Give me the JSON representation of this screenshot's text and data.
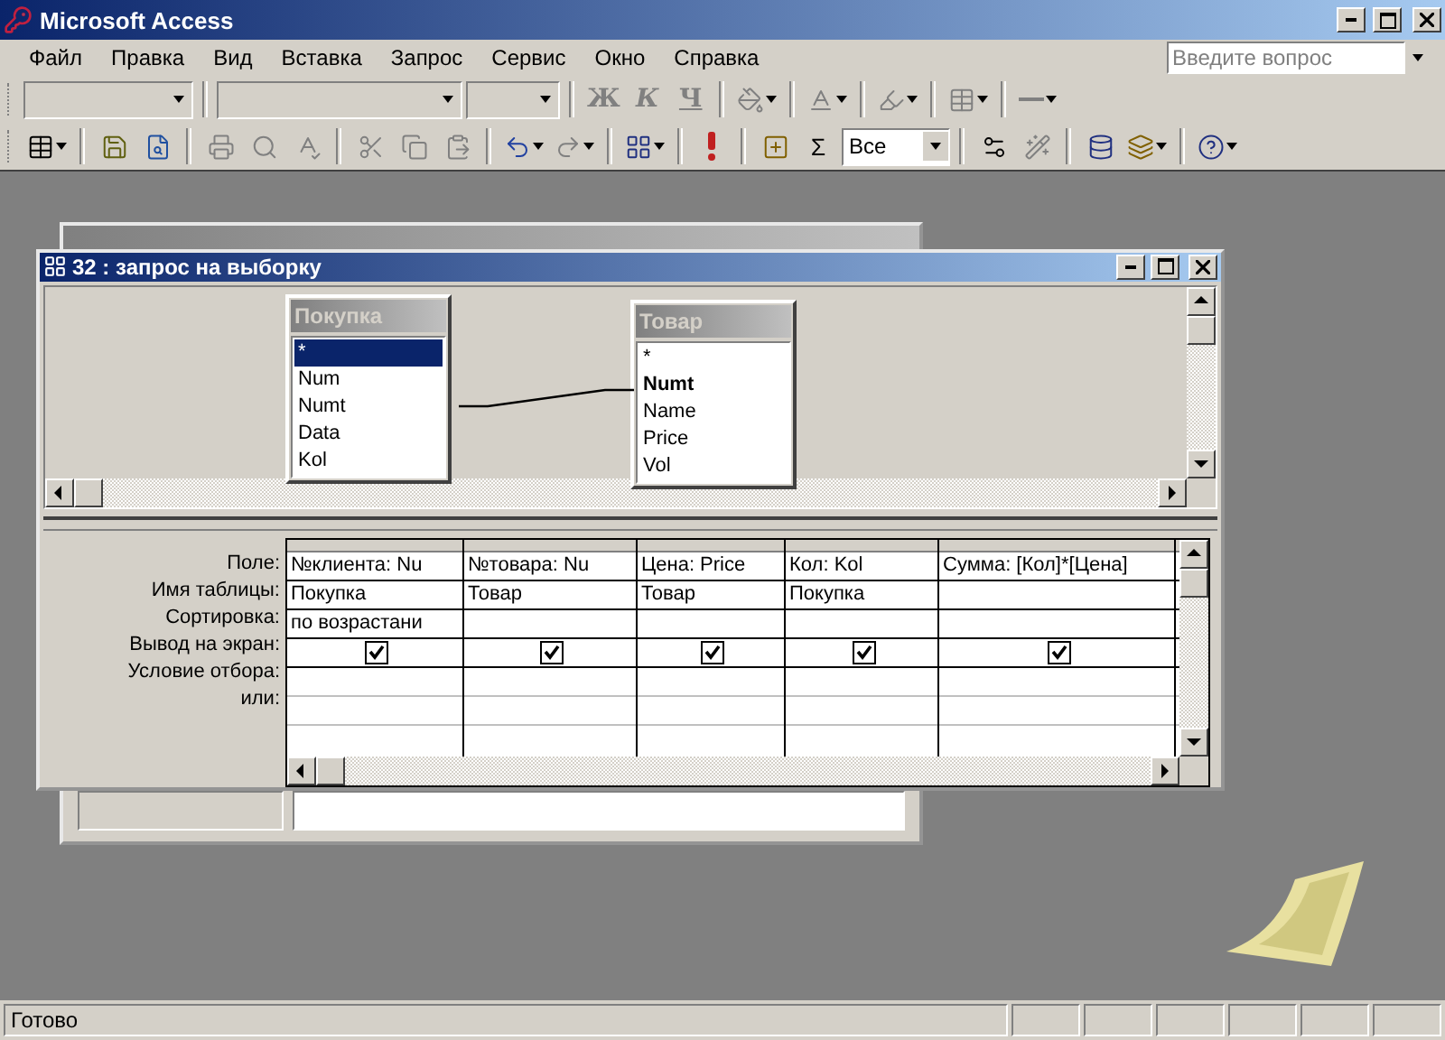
{
  "app_window": {
    "title": "Microsoft Access"
  },
  "menu": [
    {
      "label": "Файл"
    },
    {
      "label": "Правка"
    },
    {
      "label": "Вид"
    },
    {
      "label": "Вставка"
    },
    {
      "label": "Запрос"
    },
    {
      "label": "Сервис"
    },
    {
      "label": "Окно"
    },
    {
      "label": "Справка"
    }
  ],
  "help_box": {
    "placeholder": "Введите вопрос"
  },
  "formatting_toolbar": {
    "bold": "Ж",
    "italic": "К",
    "underline": "Ч"
  },
  "query_toolbar": {
    "sum": "Σ",
    "top_values": "Все"
  },
  "query_window": {
    "title": "32 : запрос на выборку",
    "tables": [
      {
        "name": "Покупка",
        "fields": [
          {
            "name": "*",
            "selected": true,
            "primary_key": false
          },
          {
            "name": "Num",
            "selected": false,
            "primary_key": false
          },
          {
            "name": "Numt",
            "selected": false,
            "primary_key": false
          },
          {
            "name": "Data",
            "selected": false,
            "primary_key": false
          },
          {
            "name": "Kol",
            "selected": false,
            "primary_key": false
          }
        ]
      },
      {
        "name": "Товар",
        "fields": [
          {
            "name": "*",
            "selected": false,
            "primary_key": false
          },
          {
            "name": "Numt",
            "selected": false,
            "primary_key": true
          },
          {
            "name": "Name",
            "selected": false,
            "primary_key": false
          },
          {
            "name": "Price",
            "selected": false,
            "primary_key": false
          },
          {
            "name": "Vol",
            "selected": false,
            "primary_key": false
          }
        ]
      }
    ],
    "grid": {
      "row_labels": [
        "Поле:",
        "Имя таблицы:",
        "Сортировка:",
        "Вывод на экран:",
        "Условие отбора:",
        "или:"
      ],
      "columns": [
        {
          "field": "№клиента: Nu",
          "table": "Покупка",
          "sort": "по возрастани",
          "show": true
        },
        {
          "field": "№товара: Nu",
          "table": "Товар",
          "show": true
        },
        {
          "field": "Цена: Price",
          "table": "Товар",
          "show": true
        },
        {
          "field": "Кол: Kol",
          "table": "Покупка",
          "show": true
        },
        {
          "field": "Сумма: [Кол]*[Цена]",
          "show": true
        }
      ]
    }
  },
  "status_bar": {
    "text": "Готово"
  }
}
